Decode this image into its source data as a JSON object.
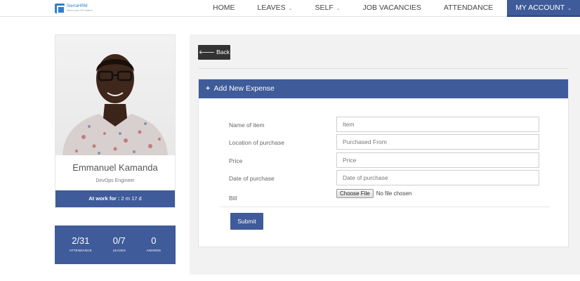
{
  "brand": {
    "name": "SierraHRM",
    "tagline": "Where your HR matters"
  },
  "nav": {
    "items": [
      {
        "label": "HOME",
        "has_dropdown": false
      },
      {
        "label": "LEAVES",
        "has_dropdown": true
      },
      {
        "label": "SELF",
        "has_dropdown": true
      },
      {
        "label": "JOB VACANCIES",
        "has_dropdown": false
      },
      {
        "label": "ATTENDANCE",
        "has_dropdown": false
      },
      {
        "label": "MY ACCOUNT",
        "has_dropdown": true,
        "active": true
      }
    ],
    "chevron": "⌄"
  },
  "profile": {
    "name": "Emmanuel Kamanda",
    "title": "DevOps Engineer",
    "work_label": "At work for :",
    "work_value": "2 m 17 d"
  },
  "stats": [
    {
      "value": "2/31",
      "label": "ATTENDANCE"
    },
    {
      "value": "0/7",
      "label": "LEAVES"
    },
    {
      "value": "0",
      "label": "AWARDS"
    }
  ],
  "page": {
    "back_icon": "arrow-left-icon",
    "back_label": "Back",
    "form_title": "Add New Expense",
    "form_icon": "plus-icon",
    "fields": [
      {
        "label": "Name of item",
        "placeholder": "Item",
        "value": ""
      },
      {
        "label": "Location of purchase",
        "placeholder": "Purchased From",
        "value": ""
      },
      {
        "label": "Price",
        "placeholder": "Price",
        "value": ""
      },
      {
        "label": "Date of purchase",
        "placeholder": "Date of purchase",
        "value": ""
      }
    ],
    "bill": {
      "label": "Bill",
      "button_label": "Choose File",
      "status": "No file chosen"
    },
    "submit_label": "Submit"
  },
  "colors": {
    "accent": "#3f5b99",
    "back_button": "#333333",
    "panel_bg": "#f2f2f2"
  }
}
